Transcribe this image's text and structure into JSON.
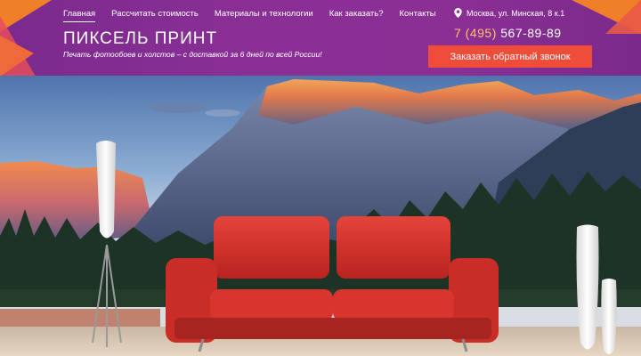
{
  "nav": {
    "items": [
      "Главная",
      "Рассчитать стоимость",
      "Материалы и технологии",
      "Как заказать?",
      "Контакты"
    ],
    "active_index": 0
  },
  "brand": {
    "name": "ПИКСЕЛЬ ПРИНТ",
    "tagline": "Печать фотообоев и холстов – с доставкой за 6 дней по всей России!"
  },
  "contact": {
    "address": "Москва, ул. Минская, 8 к.1",
    "phone_code": "7 (495)",
    "phone_number": "567-89-89",
    "callback_label": "Заказать обратный звонок"
  },
  "colors": {
    "header_bg": "#8a2f96",
    "accent_orange": "#f07f2a",
    "button_red": "#ef4c3a",
    "phone_code": "#ffc36a"
  }
}
